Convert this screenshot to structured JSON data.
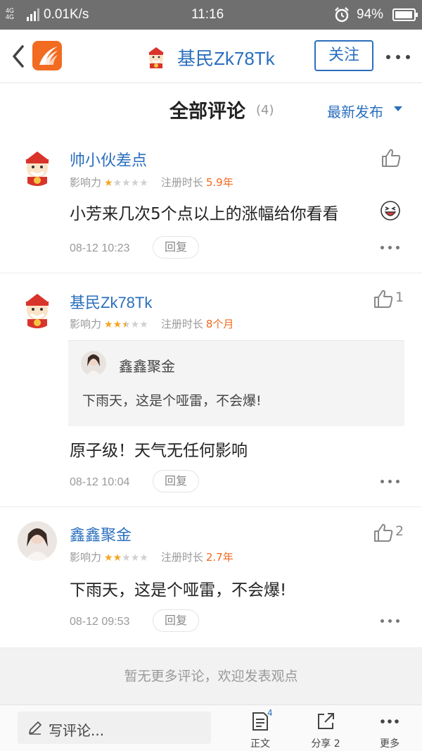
{
  "status_bar": {
    "network_top": "4G",
    "network_bottom": "4G",
    "speed": "0.01K/s",
    "time": "11:16",
    "battery": "94%",
    "battery_level": 0.94
  },
  "header": {
    "name": "基民Zk78Tk",
    "follow_label": "关注",
    "icons": [
      "back-arrow-icon",
      "app-logo",
      "avatar",
      "more-dots-icon"
    ]
  },
  "section": {
    "title": "全部评论",
    "count": "(4)",
    "sort_label": "最新发布"
  },
  "comments": [
    {
      "user": "帅小伙差点",
      "influence_label": "影响力",
      "stars": 1,
      "reg_label": "注册时长",
      "reg_value": "5.9年",
      "likes": "",
      "text": "小芳来几次5个点以上的涨幅给你看看",
      "time": "08-12 10:23",
      "reply_label": "回复"
    },
    {
      "user": "基民Zk78Tk",
      "influence_label": "影响力",
      "stars": 2.5,
      "reg_label": "注册时长",
      "reg_value": "8个月",
      "likes": "1",
      "quote": {
        "user": "鑫鑫聚金",
        "text": "下雨天，这是个哑雷，不会爆!"
      },
      "text": "原子级！天气无任何影响",
      "time": "08-12 10:04",
      "reply_label": "回复"
    },
    {
      "user": "鑫鑫聚金",
      "influence_label": "影响力",
      "stars": 2,
      "reg_label": "注册时长",
      "reg_value": "2.7年",
      "likes": "2",
      "text": "下雨天，这是个哑雷，不会爆!",
      "time": "08-12 09:53",
      "reply_label": "回复"
    }
  ],
  "no_more_text": "暂无更多评论，欢迎发表观点",
  "bottom_bar": {
    "write_placeholder": "写评论...",
    "body_label": "正文",
    "body_badge": "4",
    "share_label": "分享 2",
    "more_label": "更多"
  },
  "colors": {
    "link_blue": "#2b6fbe",
    "accent_orange": "#f06a1f",
    "star": "#f5a623"
  }
}
